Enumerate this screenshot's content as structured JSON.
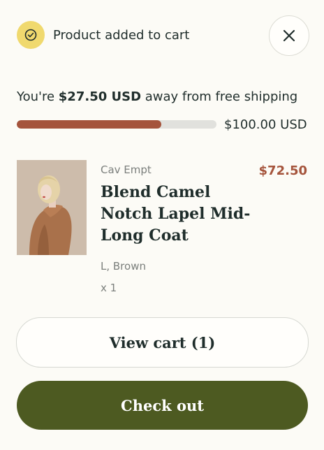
{
  "notification": {
    "icon": "check-circle-icon",
    "text": "Product added to cart"
  },
  "close": {
    "icon": "close-icon"
  },
  "shipping": {
    "prefix": "You're ",
    "amount": "$27.50 USD",
    "suffix": " away from free shipping",
    "threshold": "$100.00 USD",
    "progress_percent": 72.5
  },
  "product": {
    "vendor": "Cav Empt",
    "title": "Blend Camel Notch Lapel Mid-Long Coat",
    "price": "$72.50",
    "variant": "L, Brown",
    "quantity": "x 1",
    "image_icon": "product-photo"
  },
  "actions": {
    "view_cart": "View cart (1)",
    "checkout": "Check out"
  },
  "colors": {
    "accent": "#a5543c",
    "checkout_bg": "#4d5a21",
    "badge": "#f0d96e",
    "background": "#fcfbf6"
  }
}
